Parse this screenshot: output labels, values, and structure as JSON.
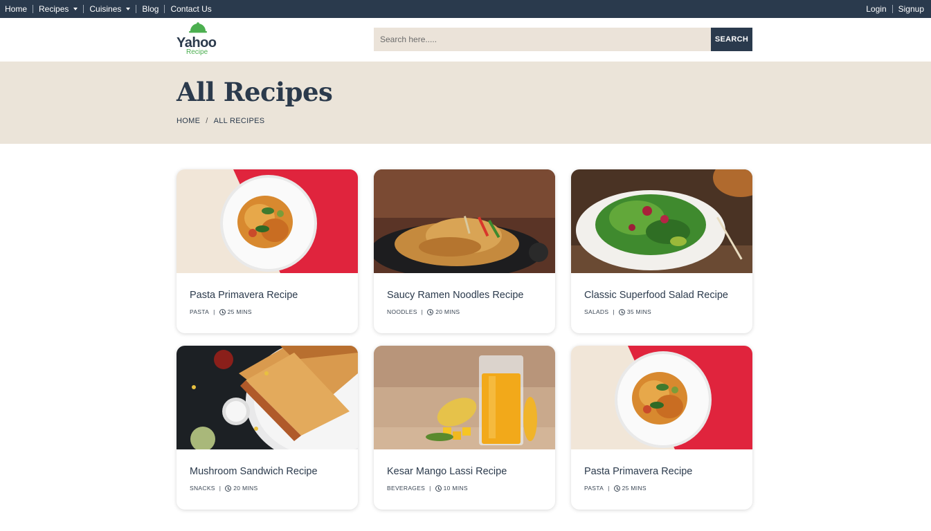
{
  "topbar": {
    "nav": [
      {
        "label": "Home",
        "dropdown": false
      },
      {
        "label": "Recipes",
        "dropdown": true
      },
      {
        "label": "Cuisines",
        "dropdown": true
      },
      {
        "label": "Blog",
        "dropdown": false
      },
      {
        "label": "Contact Us",
        "dropdown": false
      }
    ],
    "login": "Login",
    "signup": "Signup"
  },
  "header": {
    "logo_word": "Yahoo",
    "logo_sub": "Recipe",
    "search_placeholder": "Search here.....",
    "search_button": "SEARCH"
  },
  "hero": {
    "title": "All Recipes",
    "breadcrumb": [
      "HOME",
      "ALL RECIPES"
    ]
  },
  "recipes": [
    {
      "title": "Pasta Primavera Recipe",
      "category": "PASTA",
      "time": "25 MINS",
      "image": "pasta"
    },
    {
      "title": "Saucy Ramen Noodles Recipe",
      "category": "NOODLES",
      "time": "20 MINS",
      "image": "noodles"
    },
    {
      "title": "Classic Superfood Salad Recipe",
      "category": "SALADS",
      "time": "35 MINS",
      "image": "salad"
    },
    {
      "title": "Mushroom Sandwich Recipe",
      "category": "SNACKS",
      "time": "20 MINS",
      "image": "sandwich"
    },
    {
      "title": "Kesar Mango Lassi Recipe",
      "category": "BEVERAGES",
      "time": "10 MINS",
      "image": "lassi"
    },
    {
      "title": "Pasta Primavera Recipe",
      "category": "PASTA",
      "time": "25 MINS",
      "image": "pasta"
    }
  ],
  "colors": {
    "navy": "#2a3a4d",
    "beige": "#ebe4d9",
    "logo_green": "#4caf50"
  }
}
